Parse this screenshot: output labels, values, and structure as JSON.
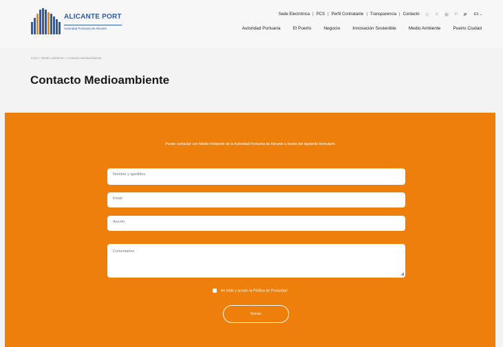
{
  "logo": {
    "title": "ALICANTE PORT",
    "subtitle": "Autoridad Portuaria de Alicante"
  },
  "topbar": {
    "links": [
      "Sede Electrónica",
      "PCS",
      "Perfil Contratante",
      "Transparencia",
      "Contacto"
    ],
    "icons": [
      "instagram-icon",
      "x-icon",
      "youtube-icon",
      "linkedin-icon"
    ],
    "language": "ES"
  },
  "nav": {
    "items": [
      "Autoridad Portuaria",
      "El Puerto",
      "Negocio",
      "Innovación Sostenible",
      "Medio Ambiente",
      "Puerto Ciudad"
    ]
  },
  "breadcrumb": "Inicio > Medio ambiente > Contacto Medioambiente",
  "page": {
    "title": "Contacto Medioambiente"
  },
  "form": {
    "intro": "Puede contactar con Medio Ambiente de la Autoridad Portuaria de Alicante a través del siguiente formulario",
    "fields": {
      "name_placeholder": "Nombre y apellidos",
      "email_placeholder": "Email",
      "subject_placeholder": "Asunto",
      "comments_placeholder": "Comentarios"
    },
    "privacy": "He leído y acepto la Política de Privacidad",
    "submit": "Enviar"
  },
  "colors": {
    "accent": "#ee7f0a",
    "brand": "#2f5aa8"
  }
}
